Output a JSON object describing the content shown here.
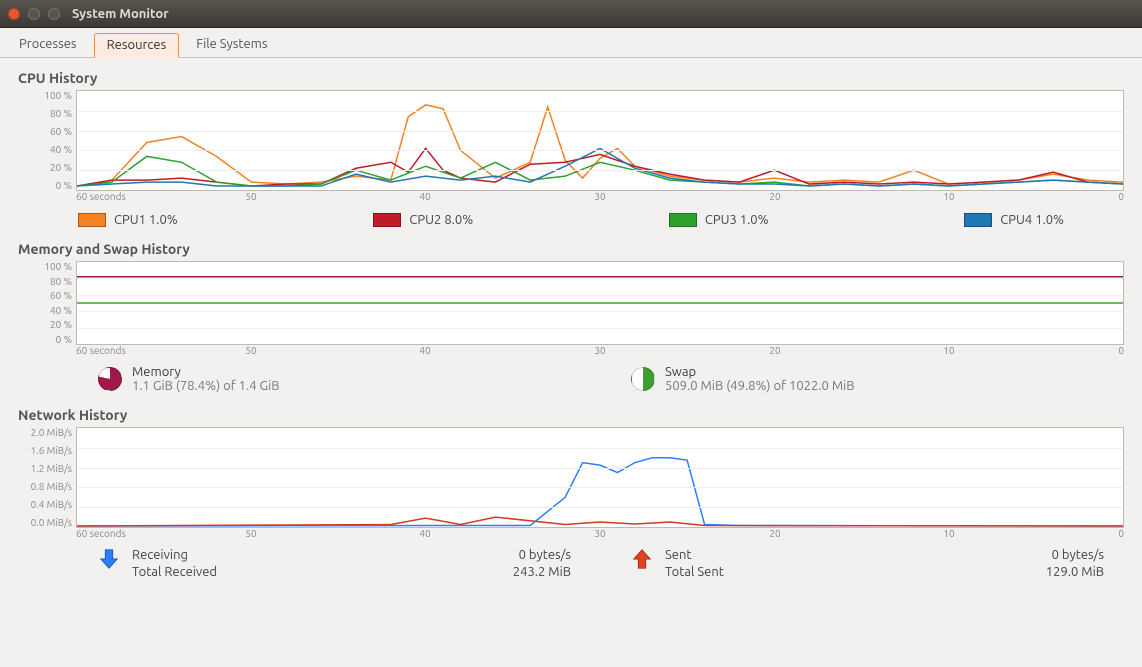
{
  "window_title": "System Monitor",
  "tabs": {
    "processes": "Processes",
    "resources": "Resources",
    "filesystems": "File Systems",
    "active": "resources"
  },
  "cpu": {
    "title": "CPU History",
    "yticks": [
      "100 %",
      "80 %",
      "60 %",
      "40 %",
      "20 %",
      "0 %"
    ],
    "xticks_label_left": "60 seconds",
    "xticks": [
      "50",
      "40",
      "30",
      "20",
      "10",
      "0"
    ],
    "legend": [
      {
        "id": "cpu1",
        "label": "CPU1  1.0%",
        "color": "#f58220"
      },
      {
        "id": "cpu2",
        "label": "CPU2  8.0%",
        "color": "#c01c28"
      },
      {
        "id": "cpu3",
        "label": "CPU3  1.0%",
        "color": "#2ea02c"
      },
      {
        "id": "cpu4",
        "label": "CPU4  1.0%",
        "color": "#1f78b4"
      }
    ]
  },
  "mem": {
    "title": "Memory and Swap History",
    "yticks": [
      "100 %",
      "80 %",
      "60 %",
      "40 %",
      "20 %",
      "0 %"
    ],
    "xticks_label_left": "60 seconds",
    "xticks": [
      "50",
      "40",
      "30",
      "20",
      "10",
      "0"
    ],
    "memory_label": "Memory",
    "memory_detail": "1.1 GiB (78.4%) of 1.4 GiB",
    "memory_color": "#9e1a4c",
    "memory_pct": 78.4,
    "swap_label": "Swap",
    "swap_detail": "509.0 MiB (49.8%) of 1022.0 MiB",
    "swap_color": "#3fa02c",
    "swap_pct": 49.8
  },
  "net": {
    "title": "Network History",
    "yticks": [
      "2.0 MiB/s",
      "1.6 MiB/s",
      "1.2 MiB/s",
      "0.8 MiB/s",
      "0.4 MiB/s",
      "0.0 MiB/s"
    ],
    "xticks_label_left": "60 seconds",
    "xticks": [
      "50",
      "40",
      "30",
      "20",
      "10",
      "0"
    ],
    "recv_label": "Receiving",
    "recv_rate": "0 bytes/s",
    "recv_total_label": "Total Received",
    "recv_total": "243.2 MiB",
    "recv_color": "#2a7fff",
    "sent_label": "Sent",
    "sent_rate": "0 bytes/s",
    "sent_total_label": "Total Sent",
    "sent_total": "129.0 MiB",
    "sent_color": "#d43a1f"
  },
  "chart_data": [
    {
      "type": "line",
      "title": "CPU History",
      "x_unit": "seconds ago",
      "xlim": [
        60,
        0
      ],
      "ylim": [
        0,
        100
      ],
      "ylabel": "%",
      "series": [
        {
          "name": "CPU1",
          "color": "#f58220",
          "x": [
            60,
            58,
            56,
            54,
            52,
            50,
            48,
            46,
            44,
            42,
            41,
            40,
            39,
            38,
            36,
            34,
            33,
            32,
            31,
            30,
            29,
            28,
            26,
            24,
            22,
            20,
            18,
            16,
            14,
            12,
            10,
            8,
            6,
            4,
            2,
            0
          ],
          "values": [
            4,
            10,
            48,
            54,
            34,
            8,
            6,
            8,
            14,
            10,
            74,
            86,
            82,
            40,
            12,
            28,
            84,
            30,
            12,
            32,
            42,
            24,
            14,
            10,
            8,
            12,
            8,
            10,
            8,
            20,
            6,
            8,
            10,
            16,
            10,
            8
          ]
        },
        {
          "name": "CPU2",
          "color": "#c01c28",
          "x": [
            60,
            58,
            56,
            54,
            52,
            50,
            48,
            46,
            44,
            42,
            41,
            40,
            39,
            38,
            36,
            34,
            32,
            30,
            28,
            26,
            24,
            22,
            20,
            18,
            16,
            14,
            12,
            10,
            8,
            6,
            4,
            2,
            0
          ],
          "values": [
            4,
            10,
            10,
            12,
            8,
            4,
            6,
            6,
            22,
            28,
            18,
            42,
            20,
            12,
            8,
            26,
            28,
            36,
            24,
            16,
            10,
            8,
            20,
            6,
            8,
            6,
            8,
            6,
            8,
            10,
            18,
            8,
            6
          ]
        },
        {
          "name": "CPU3",
          "color": "#2ea02c",
          "x": [
            60,
            58,
            56,
            54,
            52,
            50,
            48,
            46,
            44,
            42,
            40,
            38,
            36,
            34,
            32,
            30,
            28,
            26,
            24,
            22,
            20,
            18,
            16,
            14,
            12,
            10,
            8,
            6,
            4,
            2,
            0
          ],
          "values": [
            4,
            8,
            34,
            28,
            8,
            4,
            4,
            6,
            20,
            10,
            24,
            12,
            28,
            10,
            14,
            28,
            20,
            10,
            8,
            6,
            8,
            4,
            6,
            4,
            6,
            4,
            6,
            8,
            10,
            8,
            6
          ]
        },
        {
          "name": "CPU4",
          "color": "#1f78b4",
          "x": [
            60,
            58,
            56,
            54,
            52,
            50,
            48,
            46,
            44,
            42,
            40,
            38,
            36,
            34,
            32,
            30,
            28,
            26,
            24,
            22,
            20,
            18,
            16,
            14,
            12,
            10,
            8,
            6,
            4,
            2,
            0
          ],
          "values": [
            4,
            6,
            8,
            8,
            4,
            4,
            4,
            4,
            16,
            8,
            14,
            10,
            14,
            8,
            24,
            42,
            22,
            12,
            8,
            6,
            6,
            4,
            6,
            4,
            6,
            4,
            6,
            8,
            10,
            8,
            6
          ]
        }
      ]
    },
    {
      "type": "line",
      "title": "Memory and Swap History",
      "x_unit": "seconds ago",
      "xlim": [
        60,
        0
      ],
      "ylim": [
        0,
        100
      ],
      "ylabel": "%",
      "series": [
        {
          "name": "Memory",
          "color": "#9e1a4c",
          "x": [
            60,
            0
          ],
          "values": [
            82,
            82
          ]
        },
        {
          "name": "Swap",
          "color": "#3fa02c",
          "x": [
            60,
            0
          ],
          "values": [
            50,
            50
          ]
        }
      ]
    },
    {
      "type": "line",
      "title": "Network History",
      "x_unit": "seconds ago",
      "xlim": [
        60,
        0
      ],
      "ylim": [
        0,
        2.0
      ],
      "ylabel": "MiB/s",
      "series": [
        {
          "name": "Receiving",
          "color": "#2a7fff",
          "x": [
            60,
            40,
            34,
            32,
            31,
            30,
            29,
            28,
            27,
            26,
            25,
            24,
            22,
            0
          ],
          "values": [
            0.02,
            0.03,
            0.03,
            0.6,
            1.3,
            1.25,
            1.1,
            1.3,
            1.4,
            1.4,
            1.35,
            0.05,
            0.03,
            0.02
          ]
        },
        {
          "name": "Sent",
          "color": "#d43a1f",
          "x": [
            60,
            42,
            40,
            38,
            36,
            32,
            30,
            28,
            26,
            24,
            0
          ],
          "values": [
            0.02,
            0.05,
            0.18,
            0.05,
            0.2,
            0.05,
            0.1,
            0.06,
            0.1,
            0.03,
            0.02
          ]
        }
      ]
    }
  ]
}
